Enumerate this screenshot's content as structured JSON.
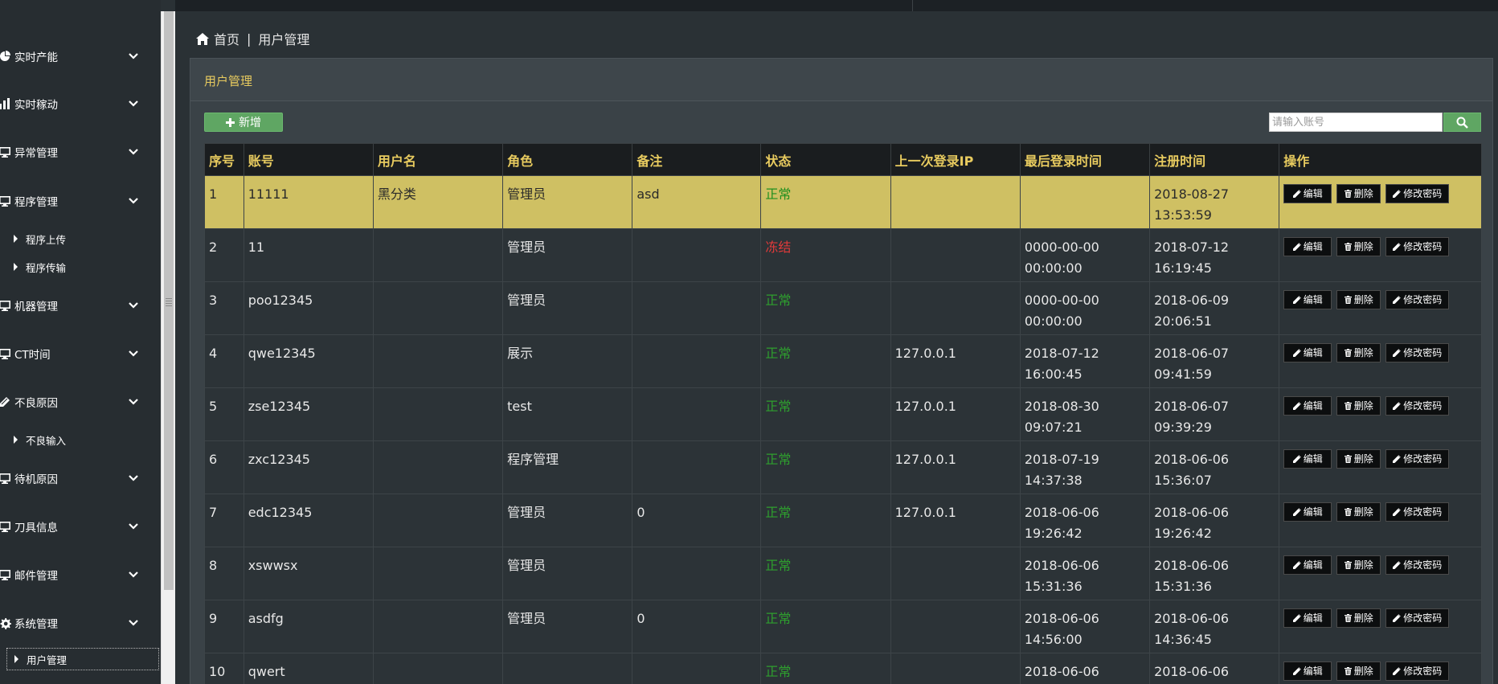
{
  "breadcrumb": {
    "home": "首页",
    "separator": "|",
    "current": "用户管理"
  },
  "sidebar": {
    "items": [
      {
        "label": "实时产能",
        "icon": "pie-chart-icon"
      },
      {
        "label": "实时稼动",
        "icon": "bar-chart-icon"
      },
      {
        "label": "异常管理",
        "icon": "monitor-icon"
      },
      {
        "label": "程序管理",
        "icon": "monitor-icon"
      },
      {
        "label": "机器管理",
        "icon": "monitor-icon"
      },
      {
        "label": "CT时间",
        "icon": "monitor-icon"
      },
      {
        "label": "不良原因",
        "icon": "edit-icon"
      },
      {
        "label": "待机原因",
        "icon": "monitor-icon"
      },
      {
        "label": "刀具信息",
        "icon": "monitor-icon"
      },
      {
        "label": "邮件管理",
        "icon": "monitor-icon"
      },
      {
        "label": "系统管理",
        "icon": "gear-icon"
      }
    ],
    "subitems": {
      "program_upload": "程序上传",
      "program_transfer": "程序传输",
      "defect_input": "不良输入",
      "user_mgmt": "用户管理"
    }
  },
  "panel": {
    "title": "用户管理",
    "add_label": "新增",
    "search_placeholder": "请输入账号"
  },
  "table": {
    "headers": [
      "序号",
      "账号",
      "用户名",
      "角色",
      "备注",
      "状态",
      "上一次登录IP",
      "最后登录时间",
      "注册时间",
      "操作"
    ],
    "actions": {
      "edit": "编辑",
      "delete": "删除",
      "change_password": "修改密码"
    },
    "rows": [
      {
        "no": "1",
        "account": "11111",
        "username": "黑分类",
        "role": "管理员",
        "note": "asd",
        "status": "正常",
        "ip": "",
        "last_login_date": "",
        "last_login_time": "",
        "reg_date": "2018-08-27",
        "reg_time": "13:53:59"
      },
      {
        "no": "2",
        "account": "11",
        "username": "",
        "role": "管理员",
        "note": "",
        "status": "冻结",
        "ip": "",
        "last_login_date": "0000-00-00",
        "last_login_time": "00:00:00",
        "reg_date": "2018-07-12",
        "reg_time": "16:19:45"
      },
      {
        "no": "3",
        "account": "poo12345",
        "username": "",
        "role": "管理员",
        "note": "",
        "status": "正常",
        "ip": "",
        "last_login_date": "0000-00-00",
        "last_login_time": "00:00:00",
        "reg_date": "2018-06-09",
        "reg_time": "20:06:51"
      },
      {
        "no": "4",
        "account": "qwe12345",
        "username": "",
        "role": "展示",
        "note": "",
        "status": "正常",
        "ip": "127.0.0.1",
        "last_login_date": "2018-07-12",
        "last_login_time": "16:00:45",
        "reg_date": "2018-06-07",
        "reg_time": "09:41:59"
      },
      {
        "no": "5",
        "account": "zse12345",
        "username": "",
        "role": "test",
        "note": "",
        "status": "正常",
        "ip": "127.0.0.1",
        "last_login_date": "2018-08-30",
        "last_login_time": "09:07:21",
        "reg_date": "2018-06-07",
        "reg_time": "09:39:29"
      },
      {
        "no": "6",
        "account": "zxc12345",
        "username": "",
        "role": "程序管理",
        "note": "",
        "status": "正常",
        "ip": "127.0.0.1",
        "last_login_date": "2018-07-19",
        "last_login_time": "14:37:38",
        "reg_date": "2018-06-06",
        "reg_time": "15:36:07"
      },
      {
        "no": "7",
        "account": "edc12345",
        "username": "",
        "role": "管理员",
        "note": "0",
        "status": "正常",
        "ip": "127.0.0.1",
        "last_login_date": "2018-06-06",
        "last_login_time": "19:26:42",
        "reg_date": "2018-06-06",
        "reg_time": "19:26:42"
      },
      {
        "no": "8",
        "account": "xswwsx",
        "username": "",
        "role": "管理员",
        "note": "",
        "status": "正常",
        "ip": "",
        "last_login_date": "2018-06-06",
        "last_login_time": "15:31:36",
        "reg_date": "2018-06-06",
        "reg_time": "15:31:36"
      },
      {
        "no": "9",
        "account": "asdfg",
        "username": "",
        "role": "管理员",
        "note": "0",
        "status": "正常",
        "ip": "",
        "last_login_date": "2018-06-06",
        "last_login_time": "14:56:00",
        "reg_date": "2018-06-06",
        "reg_time": "14:36:45"
      },
      {
        "no": "10",
        "account": "qwert",
        "username": "",
        "role": "",
        "note": "",
        "status": "正常",
        "ip": "",
        "last_login_date": "2018-06-06",
        "last_login_time": "",
        "reg_date": "2018-06-06",
        "reg_time": ""
      }
    ]
  },
  "colors": {
    "accent_gold": "#e8cb5f",
    "selected_row": "#cfc063",
    "status_normal": "#2e9f2e",
    "status_frozen": "#e23a3a",
    "button_green": "#5fa663"
  }
}
